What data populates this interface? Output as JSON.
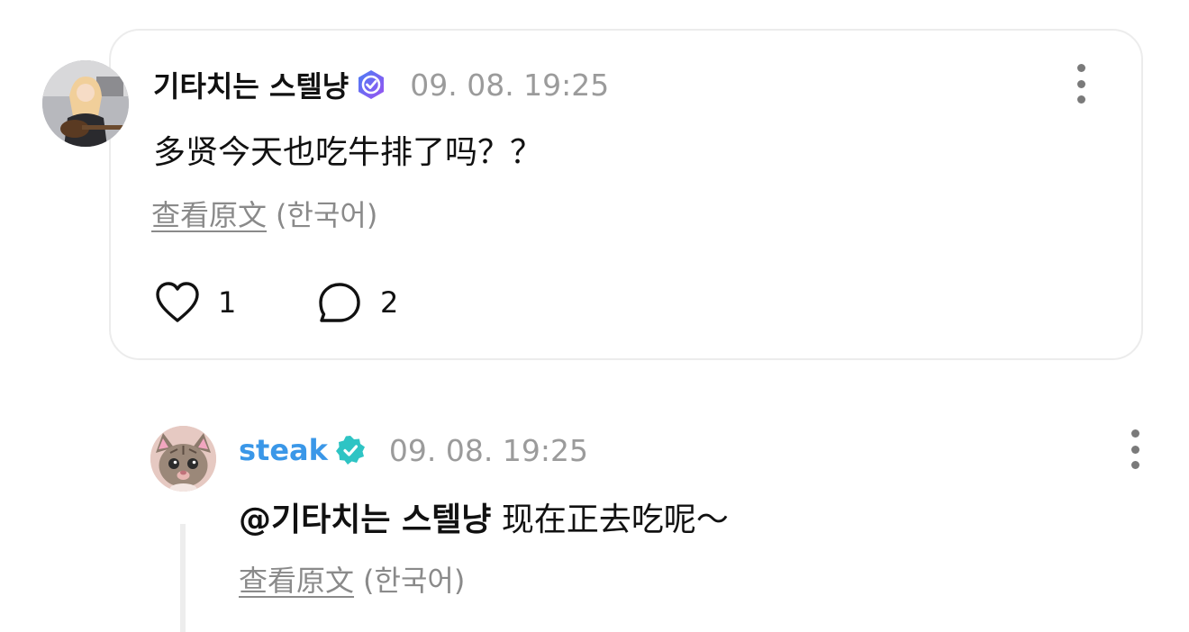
{
  "comment": {
    "author": "기타치는 스텔냥",
    "timestamp": "09. 08. 19:25",
    "text": "多贤今天也吃牛排了吗？？",
    "view_original": "查看原文",
    "original_language": "(한국어)",
    "like_count": "1",
    "reply_count": "2",
    "badge_color": "#7b5cf5"
  },
  "reply": {
    "author": "steak",
    "timestamp": "09. 08. 19:25",
    "mention": "@기타치는 스텔냥",
    "text": " 现在正去吃呢～",
    "view_original": "查看原文",
    "original_language": "(한국어)",
    "author_color": "#3a97e8",
    "badge_color": "#2ec4c4"
  }
}
